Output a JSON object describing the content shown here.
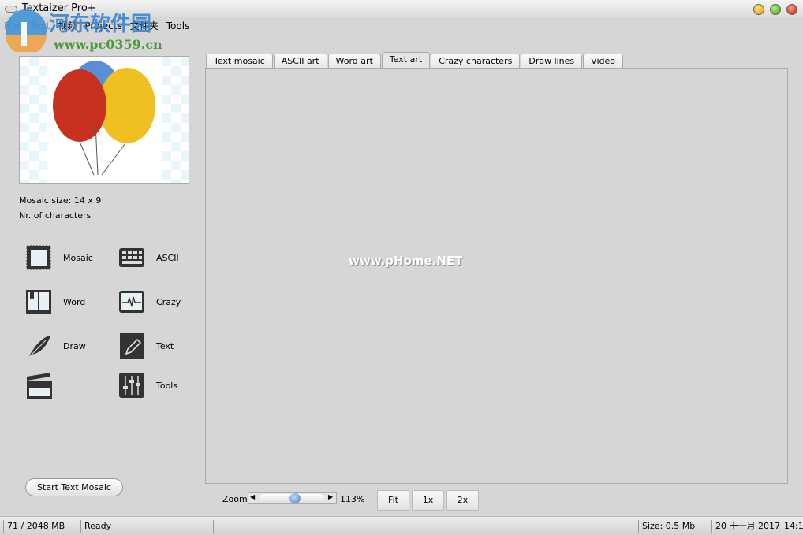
{
  "window": {
    "title": "Textaizer Pro+"
  },
  "menu": [
    "File",
    "Text",
    "视频",
    "Projects",
    "文件夹",
    "Tools"
  ],
  "watermarks": {
    "logo_text": "河东软件园",
    "logo_url": "www.pc0359.cn",
    "center": "www.pHome.NET"
  },
  "left": {
    "mosaic_size": "Mosaic size: 14 x 9",
    "nr_chars": "Nr. of characters",
    "tools": [
      {
        "label": "Mosaic",
        "icon": "stamp-icon"
      },
      {
        "label": "ASCII",
        "icon": "keyboard-icon"
      },
      {
        "label": "Word",
        "icon": "book-icon"
      },
      {
        "label": "Crazy",
        "icon": "heartbeat-monitor-icon"
      },
      {
        "label": "Draw",
        "icon": "feather-icon"
      },
      {
        "label": "Text",
        "icon": "pencil-icon"
      },
      {
        "label": "",
        "icon": "clapperboard-icon"
      },
      {
        "label": "Tools",
        "icon": "sliders-icon"
      }
    ],
    "start_button": "Start Text Mosaic"
  },
  "tabs": [
    {
      "label": "Text mosaic"
    },
    {
      "label": "ASCII art"
    },
    {
      "label": "Word art"
    },
    {
      "label": "Text art",
      "active": true
    },
    {
      "label": "Crazy characters"
    },
    {
      "label": "Draw lines"
    },
    {
      "label": "Video"
    }
  ],
  "zoom": {
    "label": "Zoom",
    "value": "113%",
    "slider_fraction": 0.5,
    "fit": "Fit",
    "one": "1x",
    "two": "2x"
  },
  "status": {
    "memory": "71 / 2048 MB",
    "state": "Ready",
    "size": "Size: 0.5 Mb",
    "date": "20 十一月 2017",
    "time": "14:1"
  }
}
